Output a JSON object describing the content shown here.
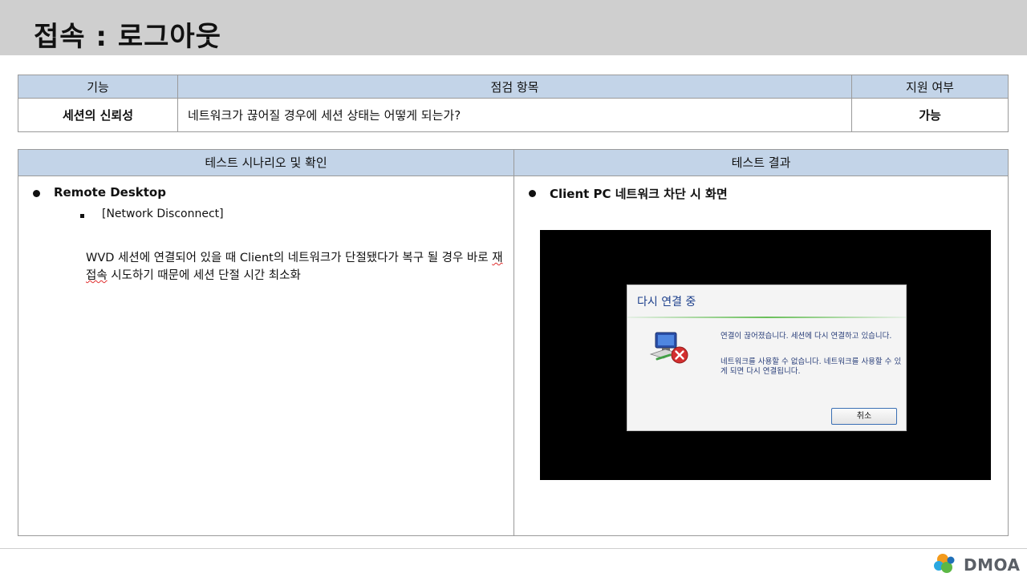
{
  "header": {
    "title": "접속 : 로그아웃"
  },
  "table": {
    "col1_header": "기능",
    "col2_header": "점검 항목",
    "col3_header": "지원 여부",
    "feature": "세션의 신뢰성",
    "check_item": "네트워크가 끊어질 경우에 세션 상태는 어떻게 되는가?",
    "support": "가능"
  },
  "left_panel": {
    "header": "테스트 시나리오 및 확인",
    "bullet": "Remote Desktop",
    "sub_item": "[Network Disconnect]",
    "desc_part1": "WVD 세션에 연결되어 있을 때 Client의 네트워크가 단절됐다가 복구 될 경우 바로 ",
    "desc_underlined": "재접속",
    "desc_part2": " 시도하기 때문에 세션 단절 시간 최소화"
  },
  "right_panel": {
    "header": "테스트 결과",
    "bullet": "Client PC 네트워크 차단 시 화면"
  },
  "dialog": {
    "title": "다시 연결 중",
    "message1": "연결이 끊어졌습니다. 세션에 다시 연결하고 있습니다.",
    "message2": "네트워크를 사용할 수 없습니다. 네트워크를 사용할 수 있게 되면 다시 연결됩니다.",
    "cancel_label": "취소",
    "icon": "network-disconnected-icon"
  },
  "footer": {
    "logo_text": "DMOA"
  }
}
